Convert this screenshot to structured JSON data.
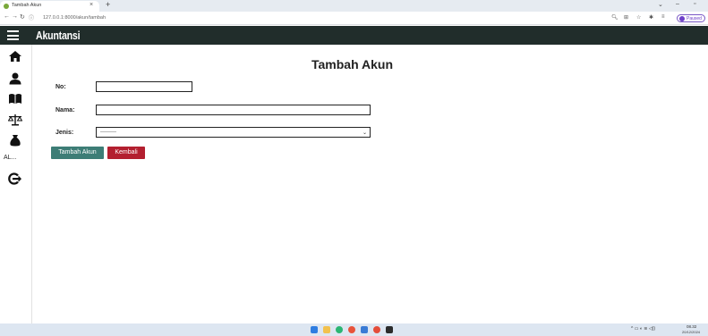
{
  "browser": {
    "tab_title": "Tambah Akun",
    "tab_close": "×",
    "new_tab": "+",
    "url": "127.0.0.1:8000/akun/tambah",
    "profile_label": "Paused",
    "window_controls": [
      "⌄",
      "–",
      "▫"
    ]
  },
  "header": {
    "title": "Akuntansi"
  },
  "sidebar": {
    "items": [
      {
        "icon": "home-icon"
      },
      {
        "icon": "user-icon"
      },
      {
        "icon": "book-icon"
      },
      {
        "icon": "scale-icon"
      },
      {
        "icon": "money-bag-icon"
      },
      {
        "label": "AL..."
      },
      {
        "icon": "logout-icon"
      }
    ]
  },
  "main": {
    "page_title": "Tambah Akun",
    "form": {
      "no_label": "No:",
      "no_value": "",
      "nama_label": "Nama:",
      "nama_value": "",
      "jenis_label": "Jenis:",
      "jenis_selected": "---------"
    },
    "buttons": {
      "submit": "Tambah Akun",
      "back": "Kembali"
    }
  },
  "taskbar": {
    "tray": "^ ▭ ◐ ≋ ◁))",
    "time": "08.32",
    "date": "20/12/2024"
  },
  "colors": {
    "header_bg": "#212d2b",
    "primary_button": "#3d7d76",
    "danger_button": "#b31f2f"
  }
}
